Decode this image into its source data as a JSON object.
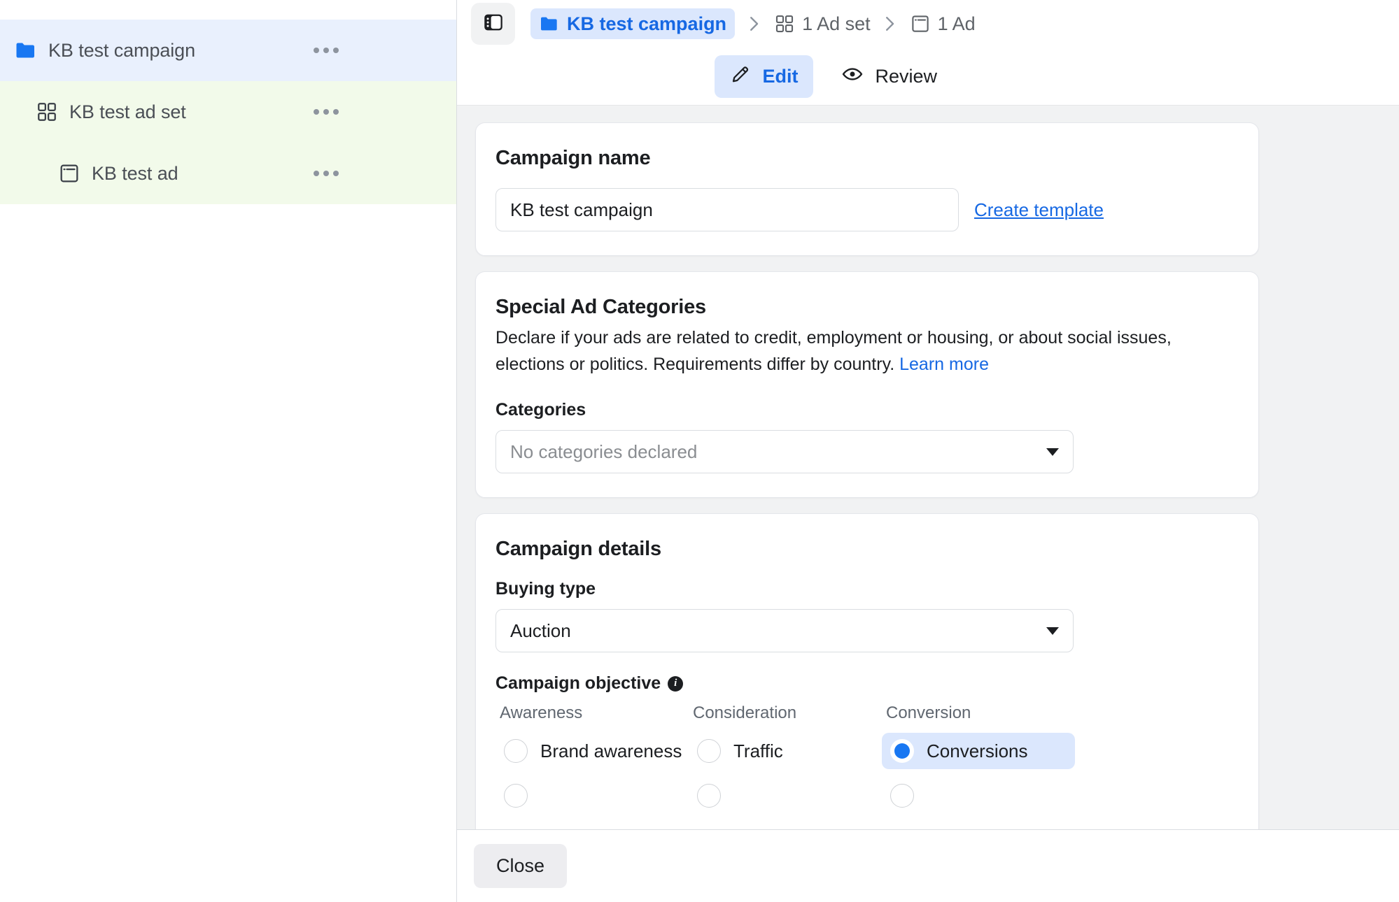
{
  "sidebar": {
    "items": [
      {
        "icon": "folder-icon",
        "label": "KB test campaign",
        "level": "campaign",
        "menu": "more-options"
      },
      {
        "icon": "grid-icon",
        "label": "KB test ad set",
        "level": "adset",
        "menu": "more-options"
      },
      {
        "icon": "ad-window-icon",
        "label": "KB test ad",
        "level": "ad",
        "menu": "more-options"
      }
    ]
  },
  "header": {
    "panel_toggle_icon": "sidebar-toggle-icon",
    "breadcrumb": [
      {
        "icon": "folder-icon",
        "label": "KB test campaign",
        "active": true
      },
      {
        "icon": "grid-icon",
        "label": "1 Ad set",
        "active": false
      },
      {
        "icon": "ad-window-icon",
        "label": "1 Ad",
        "active": false
      }
    ],
    "separator": "›",
    "tabs": [
      {
        "icon": "pencil-icon",
        "label": "Edit",
        "active": true
      },
      {
        "icon": "eye-icon",
        "label": "Review",
        "active": false
      }
    ]
  },
  "campaign_name": {
    "title": "Campaign name",
    "value": "KB test campaign",
    "placeholder": "Campaign name",
    "create_template_label": "Create template"
  },
  "special_ad_categories": {
    "title": "Special Ad Categories",
    "description": "Declare if your ads are related to credit, employment or housing, or about social issues, elections or politics. Requirements differ by country.",
    "learn_more_label": "Learn more",
    "categories_label": "Categories",
    "categories_value": "No categories declared",
    "caret_icon": "chevron-down-icon"
  },
  "campaign_details": {
    "title": "Campaign details",
    "buying_type_label": "Buying type",
    "buying_type_value": "Auction",
    "caret_icon": "chevron-down-icon",
    "objective_label": "Campaign objective",
    "objective_info_icon": "info-icon",
    "objective_columns": [
      {
        "heading": "Awareness",
        "options": [
          {
            "label": "Brand awareness",
            "selected": false
          },
          {
            "label": "",
            "selected": false
          }
        ]
      },
      {
        "heading": "Consideration",
        "options": [
          {
            "label": "Traffic",
            "selected": false
          },
          {
            "label": "",
            "selected": false
          }
        ]
      },
      {
        "heading": "Conversion",
        "options": [
          {
            "label": "Conversions",
            "selected": true
          },
          {
            "label": "",
            "selected": false
          }
        ]
      }
    ]
  },
  "footer": {
    "close_label": "Close"
  },
  "colors": {
    "accent_blue": "#1668e3",
    "selected_blue_bg": "#dbe7fd",
    "campaign_row_bg": "#e9f0fd",
    "adset_row_bg": "#f2faea",
    "radio_fill": "#1877f2",
    "content_bg": "#f1f2f3"
  }
}
